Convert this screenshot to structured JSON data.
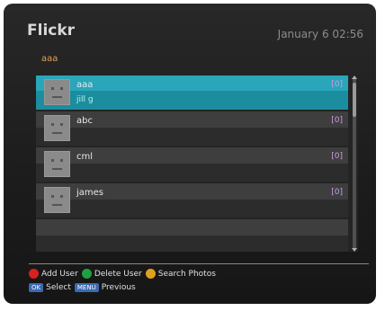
{
  "header": {
    "title": "Flickr",
    "datetime": "January 6 02:56"
  },
  "breadcrumb": "aaa",
  "users": [
    {
      "name": "aaa",
      "count": "[0]",
      "subname": "jill g",
      "selected": true
    },
    {
      "name": "abc",
      "count": "[0]",
      "subname": ""
    },
    {
      "name": "cml",
      "count": "[0]",
      "subname": ""
    },
    {
      "name": "james",
      "count": "[0]",
      "subname": ""
    }
  ],
  "help": {
    "red": "Add User",
    "green": "Delete User",
    "yellow": "Search Photos",
    "ok_key": "OK",
    "ok_label": "Select",
    "menu_key": "MENU",
    "menu_label": "Previous"
  },
  "colors": {
    "selection": "#2aa6ba",
    "red": "#d82020",
    "green": "#20a040",
    "yellow": "#e0a020"
  }
}
